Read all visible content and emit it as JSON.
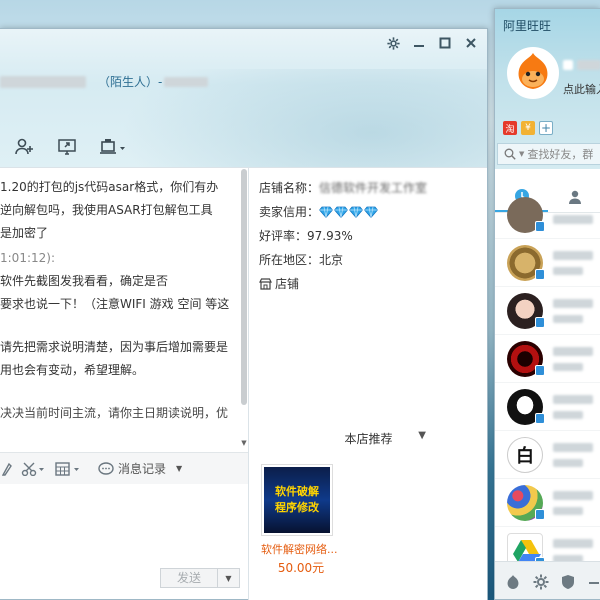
{
  "chat_window": {
    "title_tag": "（陌生人）-",
    "messages": [
      {
        "kind": "text",
        "lines": [
          "1.20的打包的js代码asar格式，你们有办",
          "逆向解包吗，我使用ASAR打包解包工具",
          "是加密了"
        ]
      },
      {
        "kind": "time",
        "text": "1:01:12):"
      },
      {
        "kind": "text",
        "lines": [
          "软件先截图发我看看，确定是否",
          "要求也说一下！（注意WIFI 游戏 空间 等这"
        ]
      },
      {
        "kind": "text",
        "lines": [
          "请先把需求说明清楚，因为事后增加需要是",
          "用也会有变动，希望理解。"
        ]
      },
      {
        "kind": "text",
        "lines": [
          "决决当前时间主流，请你主日期读说明，优"
        ]
      }
    ],
    "history_label": "消息记录",
    "send_label": "发送"
  },
  "shop": {
    "name_label": "店铺名称：",
    "name_value": "信德软件开发工作室",
    "credit_label": "卖家信用：",
    "rating": "好评率：97.93%",
    "location": "所在地区：北京",
    "shop_link": "店铺",
    "recommend_label": "本店推荐",
    "product": {
      "image_text_1": "软件破解",
      "image_text_2": "程序修改",
      "name": "软件解密网络...",
      "price": "50.00元"
    }
  },
  "contacts_window": {
    "title": "阿里旺旺",
    "status_text": "点此输入",
    "search_placeholder": "查找好友，群"
  }
}
